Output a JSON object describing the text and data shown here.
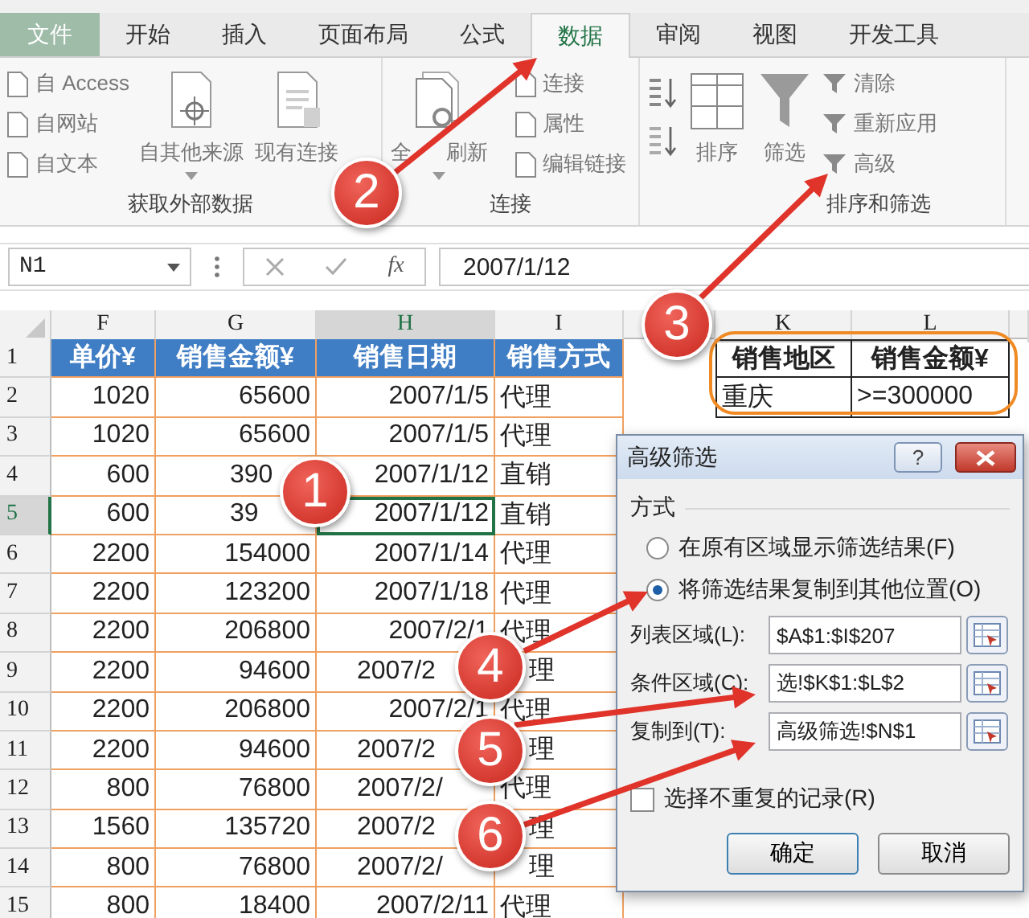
{
  "tabs": [
    {
      "label": "文件",
      "kind": "file",
      "selected": false
    },
    {
      "label": "开始",
      "kind": "tab",
      "selected": false
    },
    {
      "label": "插入",
      "kind": "tab",
      "selected": false
    },
    {
      "label": "页面布局",
      "kind": "tab",
      "selected": false
    },
    {
      "label": "公式",
      "kind": "tab",
      "selected": false
    },
    {
      "label": "数据",
      "kind": "tab",
      "selected": true
    },
    {
      "label": "审阅",
      "kind": "tab",
      "selected": false
    },
    {
      "label": "视图",
      "kind": "tab",
      "selected": false
    },
    {
      "label": "开发工具",
      "kind": "tab",
      "selected": false
    }
  ],
  "ribbon": {
    "groups": [
      {
        "label": "获取外部数据",
        "items": [
          {
            "kind": "stack",
            "items": [
              "自 Access",
              "自网站",
              "自文本"
            ]
          },
          {
            "kind": "large-menu",
            "label": "自其他来源"
          },
          {
            "kind": "large",
            "label": "现有连接"
          }
        ]
      },
      {
        "label": "连接",
        "items": [
          {
            "kind": "large-menu",
            "label": "全 刷新"
          },
          {
            "kind": "stack",
            "items": [
              "连接",
              "属性",
              "编辑链接"
            ]
          }
        ]
      },
      {
        "label": "排序和筛选",
        "items": [
          {
            "kind": "sort-pair"
          },
          {
            "kind": "large",
            "label": "排序"
          },
          {
            "kind": "large",
            "label": "筛选"
          },
          {
            "kind": "stack",
            "items": [
              "清除",
              "重新应用",
              "高级"
            ]
          }
        ]
      }
    ]
  },
  "formula_bar": {
    "name_box": "N1",
    "function_label": "fx",
    "value": "2007/1/12"
  },
  "sheet": {
    "columns": [
      {
        "label": "F",
        "selected": false
      },
      {
        "label": "G",
        "selected": false
      },
      {
        "label": "H",
        "selected": true
      },
      {
        "label": "I",
        "selected": false
      },
      {
        "selected": false
      },
      {
        "label": "K",
        "selected": false
      },
      {
        "label": "L",
        "selected": false
      }
    ],
    "rows": [
      {
        "number": "1",
        "selected": false,
        "cells": [
          "单价¥",
          "销售金额¥",
          "销售日期",
          "销售方式"
        ]
      },
      {
        "number": "2",
        "selected": false,
        "cells": [
          "1020",
          "65600",
          "2007/1/5",
          "代理"
        ]
      },
      {
        "number": "3",
        "selected": false,
        "cells": [
          "1020",
          "65600",
          "2007/1/5",
          "代理"
        ]
      },
      {
        "number": "4",
        "selected": false,
        "cells": [
          "600",
          {
            "text": "390",
            "kind": "cut"
          },
          "2007/1/12",
          "直销"
        ]
      },
      {
        "number": "5",
        "selected": true,
        "cells": [
          "600",
          {
            "text": "39",
            "kind": "cut"
          },
          "2007/1/12",
          "直销"
        ]
      },
      {
        "number": "6",
        "selected": false,
        "cells": [
          "2200",
          "154000",
          "2007/1/14",
          "代理"
        ]
      },
      {
        "number": "7",
        "selected": false,
        "cells": [
          "2200",
          "123200",
          "2007/1/18",
          "代理"
        ]
      },
      {
        "number": "8",
        "selected": false,
        "cells": [
          "2200",
          "206800",
          "2007/2/1",
          "代理"
        ]
      },
      {
        "number": "9",
        "selected": false,
        "cells": [
          "2200",
          "94600",
          {
            "text": "2007/2",
            "kind": "cut"
          },
          {
            "text": "理",
            "kind": "cut"
          }
        ]
      },
      {
        "number": "10",
        "selected": false,
        "cells": [
          "2200",
          "206800",
          "2007/2/1",
          "代理"
        ]
      },
      {
        "number": "11",
        "selected": false,
        "cells": [
          "2200",
          "94600",
          {
            "text": "2007/2",
            "kind": "cut"
          },
          {
            "text": "理",
            "kind": "cut"
          }
        ]
      },
      {
        "number": "12",
        "selected": false,
        "cells": [
          "800",
          "76800",
          {
            "text": "2007/2/",
            "kind": "cut"
          },
          "代理"
        ]
      },
      {
        "number": "13",
        "selected": false,
        "cells": [
          "1560",
          "135720",
          {
            "text": "2007/2",
            "kind": "cut"
          },
          {
            "text": "理",
            "kind": "cut"
          }
        ]
      },
      {
        "number": "14",
        "selected": false,
        "cells": [
          "800",
          "76800",
          {
            "text": "2007/2/",
            "kind": "cut"
          },
          {
            "text": "理",
            "kind": "cut"
          }
        ]
      },
      {
        "number": "15",
        "selected": false,
        "cells": [
          "800",
          "18400",
          "2007/2/11",
          "代理"
        ]
      }
    ],
    "criteria": {
      "rows": [
        [
          "销售地区",
          "销售金额¥"
        ],
        [
          "重庆",
          ">=300000"
        ]
      ]
    }
  },
  "dialog": {
    "title": "高级筛选",
    "help_button": "?",
    "section_label": "方式",
    "options": [
      {
        "label": "在原有区域显示筛选结果(F)",
        "selected": false
      },
      {
        "label": "将筛选结果复制到其他位置(O)",
        "selected": true
      }
    ],
    "fields": [
      {
        "label": "列表区域(L):",
        "value": "$A$1:$I$207"
      },
      {
        "label": "条件区域(C):",
        "value": "选!$K$1:$L$2"
      },
      {
        "label": "复制到(T):",
        "value": "高级筛选!$N$1"
      }
    ],
    "checkbox": {
      "label": "选择不重复的记录(R)",
      "checked": false
    },
    "buttons": [
      "确定",
      "取消"
    ]
  },
  "callouts": [
    {
      "number": "1"
    },
    {
      "number": "2"
    },
    {
      "number": "3"
    },
    {
      "number": "4"
    },
    {
      "number": "5"
    },
    {
      "number": "6"
    }
  ]
}
